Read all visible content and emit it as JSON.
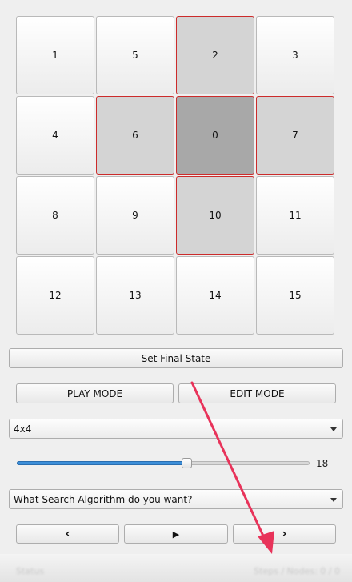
{
  "puzzle": {
    "tiles": [
      {
        "label": "1",
        "state": "normal"
      },
      {
        "label": "5",
        "state": "normal"
      },
      {
        "label": "2",
        "state": "neighbor"
      },
      {
        "label": "3",
        "state": "normal"
      },
      {
        "label": "4",
        "state": "normal"
      },
      {
        "label": "6",
        "state": "neighbor"
      },
      {
        "label": "0",
        "state": "blank"
      },
      {
        "label": "7",
        "state": "neighbor"
      },
      {
        "label": "8",
        "state": "normal"
      },
      {
        "label": "9",
        "state": "normal"
      },
      {
        "label": "10",
        "state": "neighbor"
      },
      {
        "label": "11",
        "state": "normal"
      },
      {
        "label": "12",
        "state": "normal"
      },
      {
        "label": "13",
        "state": "normal"
      },
      {
        "label": "14",
        "state": "normal"
      },
      {
        "label": "15",
        "state": "normal"
      }
    ]
  },
  "controls": {
    "set_final_state": {
      "pre": "Set ",
      "f": "F",
      "mid": "inal ",
      "s": "S",
      "post": "tate"
    },
    "play_mode": "PLAY MODE",
    "edit_mode": "EDIT MODE",
    "size_select": "4x4",
    "speed_value": "18",
    "speed_fraction": 0.58,
    "algorithm_select": "What Search Algorithm do you want?",
    "prev_icon": "‹",
    "play_icon": "▶",
    "next_icon": "›"
  },
  "statusbar": {
    "left": "Status",
    "right": "Steps / Nodes: 0 / 0"
  },
  "colors": {
    "highlight_border": "#cc2b2b",
    "slider_fill": "#3d8fd9",
    "annotation_arrow": "#e8335a"
  }
}
